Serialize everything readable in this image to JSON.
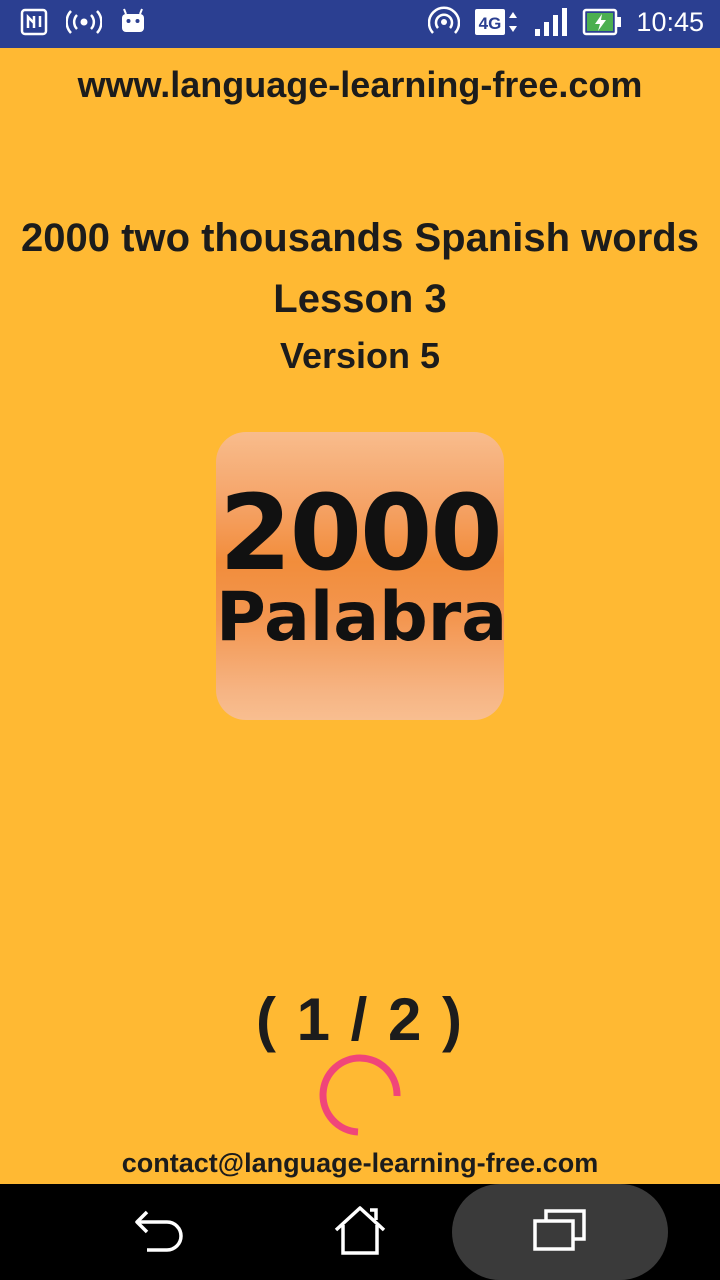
{
  "status_bar": {
    "time": "10:45",
    "network": "4G",
    "left_icons": [
      "nfc-icon",
      "wireless-broadcast-icon",
      "android-icon"
    ],
    "right_icons": [
      "hotspot-icon",
      "4g-icon",
      "signal-icon",
      "battery-charging-icon"
    ]
  },
  "content": {
    "website": "www.language-learning-free.com",
    "title": "2000 two thousands Spanish words",
    "lesson": "Lesson 3",
    "version": "Version 5",
    "logo": {
      "number": "2000",
      "word": "Palabra"
    },
    "page_counter": "( 1 / 2 )",
    "contact": "contact@language-learning-free.com"
  },
  "colors": {
    "background": "#FFB933",
    "status_bar": "#2B3F91",
    "spinner": "#F0457A",
    "nav_bar": "#000000"
  },
  "nav_bar": {
    "buttons": [
      "back-icon",
      "home-icon",
      "recents-icon"
    ]
  }
}
